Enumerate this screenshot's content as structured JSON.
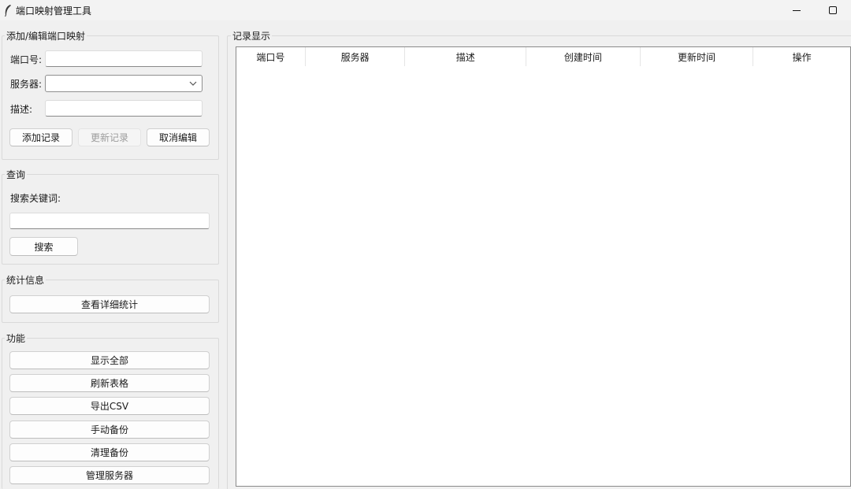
{
  "window": {
    "title": "端口映射管理工具",
    "icon": "feather-icon"
  },
  "add_edit": {
    "title": "添加/编辑端口映射",
    "port_label": "端口号:",
    "port_value": "",
    "server_label": "服务器:",
    "server_value": "",
    "desc_label": "描述:",
    "desc_value": "",
    "add_button": "添加记录",
    "update_button": "更新记录",
    "cancel_button": "取消编辑"
  },
  "query": {
    "title": "查询",
    "keyword_label": "搜索关键词:",
    "keyword_value": "",
    "search_button": "搜索"
  },
  "stats": {
    "title": "统计信息",
    "detail_button": "查看详细统计"
  },
  "functions": {
    "title": "功能",
    "buttons": [
      "显示全部",
      "刷新表格",
      "导出CSV",
      "手动备份",
      "清理备份",
      "管理服务器"
    ]
  },
  "records": {
    "title": "记录显示",
    "columns": [
      "端口号",
      "服务器",
      "描述",
      "创建时间",
      "更新时间",
      "操作"
    ],
    "rows": []
  }
}
